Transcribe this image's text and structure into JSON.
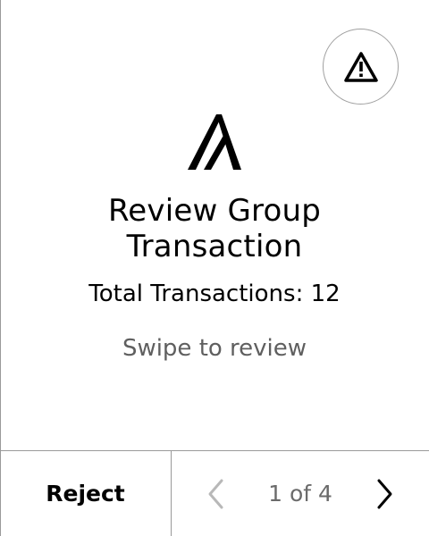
{
  "header": {
    "warning_icon": "warning-triangle-icon"
  },
  "brand": {
    "logo_icon": "algorand-logo-icon"
  },
  "main": {
    "title_line1": "Review Group",
    "title_line2": "Transaction",
    "total_label": "Total Transactions: 12",
    "hint": "Swipe to review"
  },
  "footer": {
    "reject_label": "Reject",
    "pager_label": "1 of 4",
    "prev_icon": "chevron-left-icon",
    "next_icon": "chevron-right-icon",
    "prev_enabled": false,
    "next_enabled": true
  },
  "colors": {
    "border": "#9a9a9a",
    "muted_text": "#6b6b6b",
    "disabled_icon": "#b8b8b8",
    "text": "#000000"
  }
}
